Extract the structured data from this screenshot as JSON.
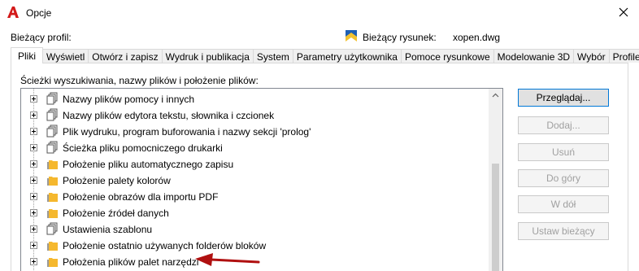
{
  "window": {
    "title": "Opcje"
  },
  "header": {
    "profile_label": "Bieżący profil:",
    "drawing_label": "Bieżący rysunek:",
    "drawing_value": "xopen.dwg"
  },
  "tabs": [
    {
      "label": "Pliki",
      "active": true
    },
    {
      "label": "Wyświetl"
    },
    {
      "label": "Otwórz i zapisz"
    },
    {
      "label": "Wydruk i publikacja"
    },
    {
      "label": "System"
    },
    {
      "label": "Parametry użytkownika"
    },
    {
      "label": "Pomoce rysunkowe"
    },
    {
      "label": "Modelowanie 3D"
    },
    {
      "label": "Wybór"
    },
    {
      "label": "Profile"
    }
  ],
  "files": {
    "section_label": "Ścieżki wyszukiwania, nazwy plików i położenie plików:",
    "tree": [
      {
        "label": "Nazwy plików pomocy i innych",
        "icon": "multi-file-icon"
      },
      {
        "label": "Nazwy plików edytora tekstu, słownika i czcionek",
        "icon": "multi-file-icon"
      },
      {
        "label": "Plik wydruku, program buforowania i nazwy sekcji 'prolog'",
        "icon": "multi-file-icon"
      },
      {
        "label": "Ścieżka pliku pomocniczego drukarki",
        "icon": "multi-file-icon"
      },
      {
        "label": "Położenie pliku automatycznego zapisu",
        "icon": "folder-icon"
      },
      {
        "label": "Położenie palety kolorów",
        "icon": "folder-icon"
      },
      {
        "label": "Położenie obrazów dla importu PDF",
        "icon": "folder-icon"
      },
      {
        "label": "Położenie źródeł danych",
        "icon": "folder-icon"
      },
      {
        "label": "Ustawienia szablonu",
        "icon": "multi-file-icon"
      },
      {
        "label": "Położenie ostatnio używanych folderów bloków",
        "icon": "folder-icon"
      },
      {
        "label": "Położenia plików palet narzędzi",
        "icon": "folder-icon"
      }
    ]
  },
  "buttons": {
    "browse": "Przeglądaj...",
    "add": "Dodaj...",
    "remove": "Usuń",
    "move_up": "Do góry",
    "move_down": "W dół",
    "set_current": "Ustaw bieżący"
  },
  "colors": {
    "accent": "#0078d7",
    "arrow": "#b01010",
    "folder": "#f5b82e"
  }
}
